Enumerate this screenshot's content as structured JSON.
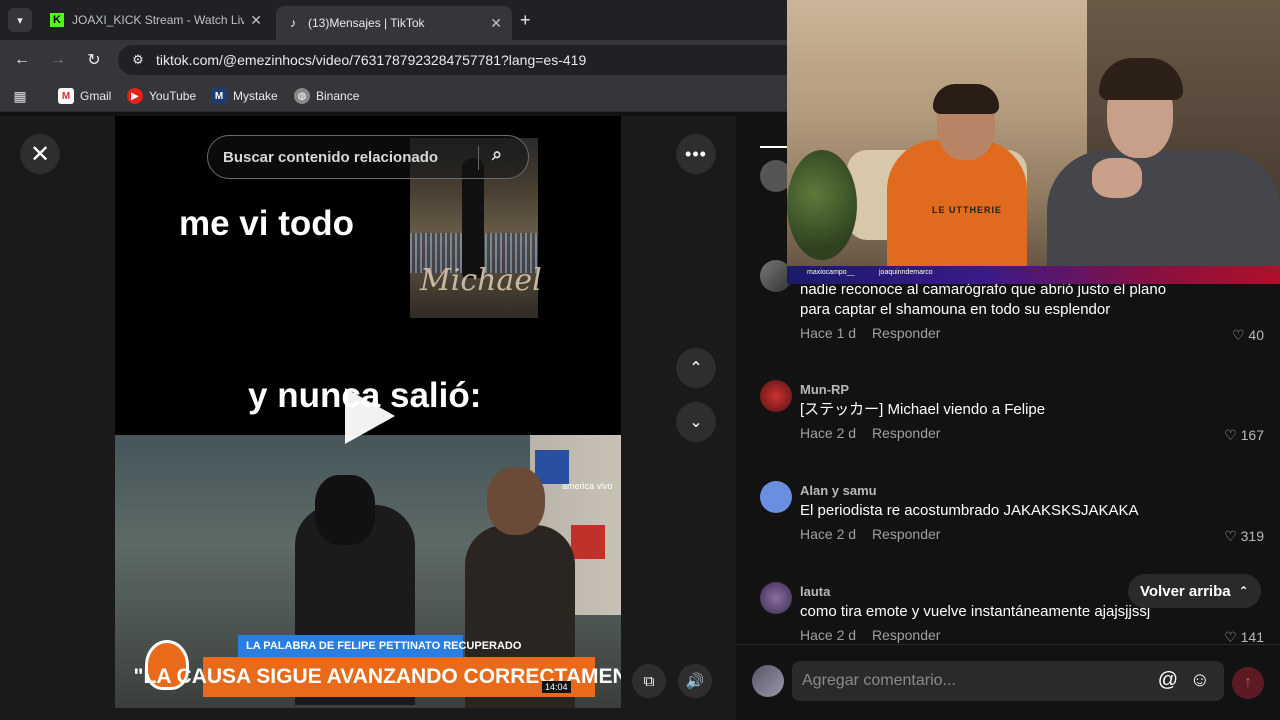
{
  "browser": {
    "tabs": [
      {
        "title": "JOAXI_KICK Stream - Watch Live",
        "favicon": "kick-logo"
      },
      {
        "title": "(13)Mensajes | TikTok",
        "favicon": "tiktok-logo"
      }
    ],
    "url": "tiktok.com/@emezinhocs/video/7631787923284757781?lang=es-419",
    "bookmarks": [
      {
        "label": "Gmail",
        "icon": "gmail-icon"
      },
      {
        "label": "YouTube",
        "icon": "youtube-icon"
      },
      {
        "label": "Mystake",
        "icon": "mystake-icon"
      },
      {
        "label": "Binance",
        "icon": "binance-icon"
      }
    ]
  },
  "video": {
    "search_placeholder": "Buscar contenido relacionado",
    "caption_top": "me vi todo",
    "caption_bottom": "y nunca salió:",
    "poster_title": "Michael",
    "news": {
      "banner_top": "LA PALABRA DE FELIPE PETTINATO RECUPERADO",
      "headline": "\"LA CAUSA SIGUE AVANZANDO CORRECTAMENTE\"",
      "clock": "14:04",
      "channel": "america vivo"
    }
  },
  "comments": [
    {
      "user": "",
      "text": "nadie reconoce al camarógrafo que abrió justo el plano para captar el shamouna en todo su esplendor",
      "time": "Hace 1 d",
      "reply": "Responder",
      "likes": "40"
    },
    {
      "user": "Mun-RP",
      "text": "[ステッカー] Michael viendo a Felipe",
      "time": "Hace 2 d",
      "reply": "Responder",
      "likes": "167"
    },
    {
      "user": "Alan y samu",
      "text": "El periodista re acostumbrado JAKAKSKSJAKAKA",
      "time": "Hace 2 d",
      "reply": "Responder",
      "likes": "319"
    },
    {
      "user": "lauta",
      "text": "como tira emote y vuelve instantáneamente ajajsjjssj",
      "time": "Hace 2 d",
      "reply": "Responder",
      "likes": "141"
    }
  ],
  "back_to_top": "Volver arriba",
  "compose_placeholder": "Agregar comentario...",
  "webcam": {
    "name_left": "maxiocampo__",
    "name_right": "joaquinndemarco",
    "shirt_text": "LE UTTHERIE"
  },
  "colors": {
    "accent_send": "#5c1b24",
    "chyron_orange": "#e86a1a",
    "chyron_blue": "#2a7de1"
  }
}
